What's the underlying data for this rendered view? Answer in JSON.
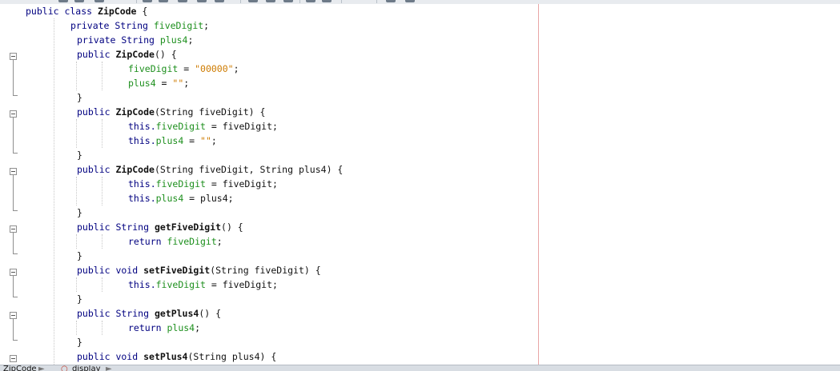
{
  "tabs": [
    {
      "label": "ZipCode"
    },
    {
      "label": "display"
    }
  ],
  "code": {
    "l0": {
      "a": "public class ",
      "b": "ZipCode",
      "c": " {"
    },
    "l1": {
      "a": "private String ",
      "b": "fiveDigit",
      "c": ";"
    },
    "l2": {
      "a": "private String ",
      "b": "plus4",
      "c": ";"
    },
    "l3": {
      "a": "public ",
      "b": "ZipCode",
      "c": "() {"
    },
    "l4": {
      "a": "fiveDigit",
      "b": " = ",
      "c": "\"00000\"",
      "d": ";"
    },
    "l5": {
      "a": "plus4",
      "b": " = ",
      "c": "\"\"",
      "d": ";"
    },
    "l6": {
      "a": "}"
    },
    "l7": {
      "a": "public ",
      "b": "ZipCode",
      "c": "(String fiveDigit) {"
    },
    "l8": {
      "a": "this.",
      "b": "fiveDigit",
      "c": " = fiveDigit;"
    },
    "l9": {
      "a": "this.",
      "b": "plus4",
      "c": " = ",
      "d": "\"\"",
      "e": ";"
    },
    "l10": {
      "a": "}"
    },
    "l11": {
      "a": "public ",
      "b": "ZipCode",
      "c": "(String fiveDigit, String plus4) {"
    },
    "l12": {
      "a": "this.",
      "b": "fiveDigit",
      "c": " = fiveDigit;"
    },
    "l13": {
      "a": "this.",
      "b": "plus4",
      "c": " = plus4;"
    },
    "l14": {
      "a": "}"
    },
    "l15": {
      "a": "public String ",
      "b": "getFiveDigit",
      "c": "() {"
    },
    "l16": {
      "a": "return ",
      "b": "fiveDigit",
      "c": ";"
    },
    "l17": {
      "a": "}"
    },
    "l18": {
      "a": "public void ",
      "b": "setFiveDigit",
      "c": "(String fiveDigit) {"
    },
    "l19": {
      "a": "this.",
      "b": "fiveDigit",
      "c": " = fiveDigit;"
    },
    "l20": {
      "a": "}"
    },
    "l21": {
      "a": "public String ",
      "b": "getPlus4",
      "c": "() {"
    },
    "l22": {
      "a": "return ",
      "b": "plus4",
      "c": ";"
    },
    "l23": {
      "a": "}"
    },
    "l24": {
      "a": "public void ",
      "b": "setPlus4",
      "c": "(String plus4) {"
    }
  },
  "colors": {
    "keyword": "#000080",
    "field": "#1d8f1d",
    "string": "#ce7b00",
    "margin_line": "#e9a6a6"
  },
  "icons": [
    "fold-collapse-icon",
    "tab-separator-icon",
    "class-icon"
  ]
}
